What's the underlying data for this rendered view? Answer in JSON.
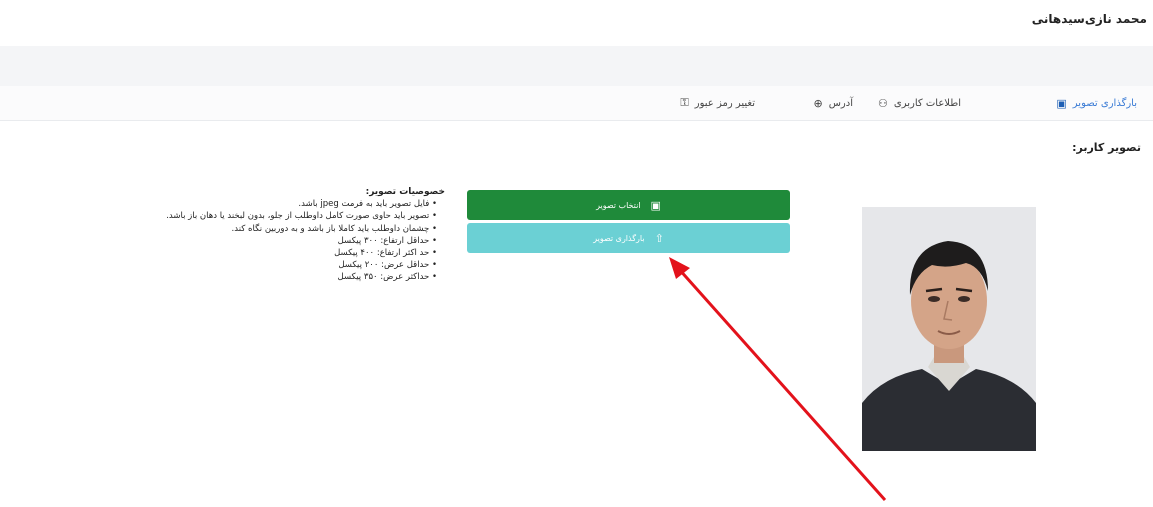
{
  "header": {
    "user_name": "محمد نازی‌سیدهانی"
  },
  "tabs": [
    {
      "label": "بارگذاری تصویر",
      "icon": "image-upload-icon",
      "active": true
    },
    {
      "label": "اطلاعات کاربری",
      "icon": "user-icon",
      "active": false
    },
    {
      "label": "آدرس",
      "icon": "location-icon",
      "active": false
    },
    {
      "label": "تغییر رمز عبور",
      "icon": "key-icon",
      "active": false
    }
  ],
  "section": {
    "title": "تصویر کاربر:"
  },
  "buttons": {
    "select_label": "انتخاب تصویر",
    "upload_label": "بارگذاری تصویر"
  },
  "specs": {
    "title": "خصوصیات تصویر:",
    "items": [
      "فایل تصویر باید به فرمت jpeg باشد.",
      "تصویر باید حاوی صورت کامل داوطلب از جلو، بدون لبخند یا دهان باز باشد.",
      "چشمان داوطلب باید کاملا باز باشد و به دوربین نگاه کند.",
      "حداقل ارتفاع: ۳۰۰ پیکسل",
      "حد اکثر ارتفاع: ۴۰۰ پیکسل",
      "حداقل عرض: ۲۰۰ پیکسل",
      "حداکثر عرض: ۳۵۰ پیکسل"
    ]
  },
  "colors": {
    "select_button": "#1f8a3a",
    "upload_button": "#6bd0d4",
    "annotation_arrow": "#e3121b"
  }
}
